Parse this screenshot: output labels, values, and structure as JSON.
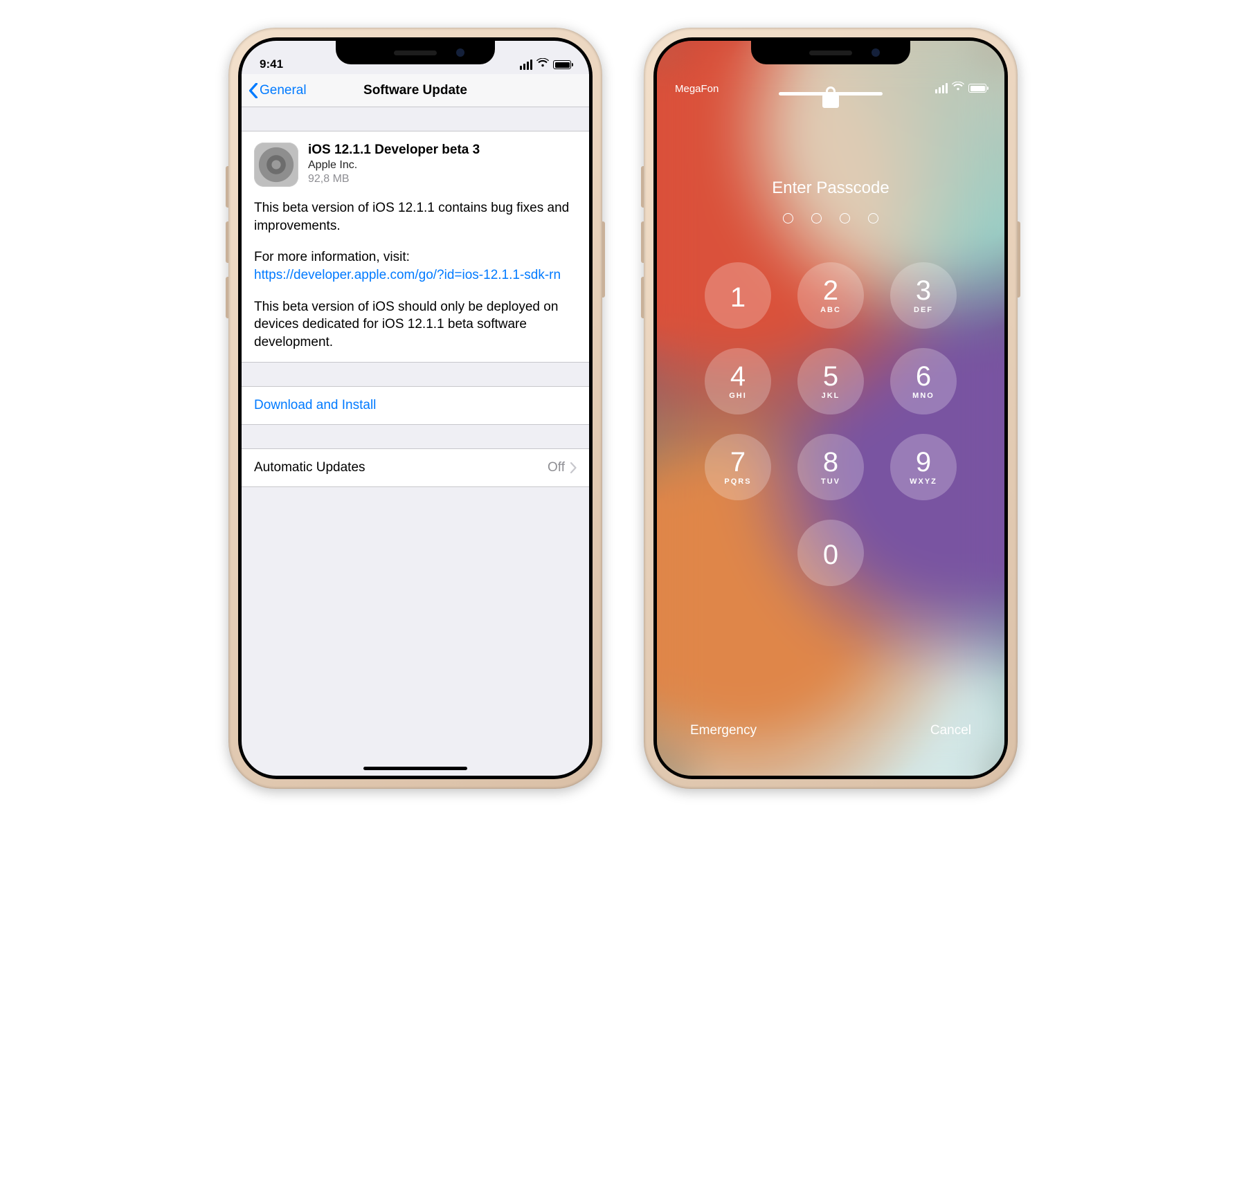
{
  "phone1": {
    "status": {
      "time": "9:41"
    },
    "nav": {
      "back_label": "General",
      "title": "Software Update"
    },
    "update": {
      "title": "iOS 12.1.1 Developer beta 3",
      "vendor": "Apple Inc.",
      "size": "92,8 MB",
      "desc1": "This beta version of iOS 12.1.1 contains bug fixes and improvements.",
      "desc2_pre": "For more information, visit:",
      "desc2_link": "https://developer.apple.com/go/?id=ios-12.1.1-sdk-rn",
      "desc3": "This beta version of iOS should only be deployed on devices dedicated for iOS 12.1.1 beta software development."
    },
    "actions": {
      "download": "Download and Install",
      "auto_label": "Automatic Updates",
      "auto_value": "Off"
    }
  },
  "phone2": {
    "status": {
      "carrier": "MegaFon"
    },
    "title": "Enter Passcode",
    "keys": [
      {
        "n": "1",
        "l": ""
      },
      {
        "n": "2",
        "l": "ABC"
      },
      {
        "n": "3",
        "l": "DEF"
      },
      {
        "n": "4",
        "l": "GHI"
      },
      {
        "n": "5",
        "l": "JKL"
      },
      {
        "n": "6",
        "l": "MNO"
      },
      {
        "n": "7",
        "l": "PQRS"
      },
      {
        "n": "8",
        "l": "TUV"
      },
      {
        "n": "9",
        "l": "WXYZ"
      },
      {
        "n": "0",
        "l": ""
      }
    ],
    "footer": {
      "emergency": "Emergency",
      "cancel": "Cancel"
    }
  }
}
